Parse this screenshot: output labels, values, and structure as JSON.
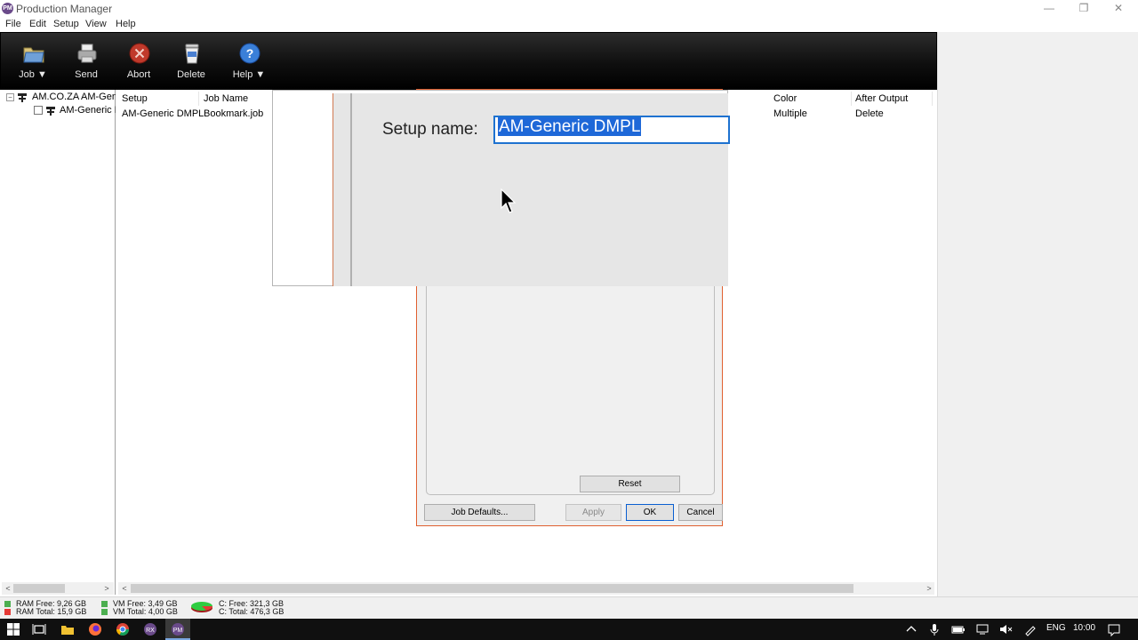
{
  "window": {
    "title": "Production Manager",
    "app_icon_text": "PM",
    "controls": {
      "minimize": "—",
      "restore": "❐",
      "close": "✕"
    }
  },
  "menu": {
    "items": [
      "File",
      "Edit",
      "Setup",
      "View",
      "Help"
    ]
  },
  "toolbar": {
    "job_label": "Job",
    "send_label": "Send",
    "abort_label": "Abort",
    "delete_label": "Delete",
    "help_label": "Help",
    "dropdown_glyph": "▼"
  },
  "tree": {
    "expand_glyph": "−",
    "root_label": "AM.CO.ZA AM-Generic DMPL",
    "child_label": "AM-Generic DMPL"
  },
  "job_list": {
    "columns": [
      "Setup",
      "Job Name",
      "Color",
      "After Output"
    ],
    "rows": [
      {
        "setup": "AM-Generic DMPL",
        "job_name": "Bookmark.job",
        "color": "Multiple",
        "after_output": "Delete"
      }
    ]
  },
  "scroll": {
    "left_arrow": "<",
    "right_arrow": ">"
  },
  "dialog": {
    "reset_label": "Reset",
    "job_defaults_label": "Job Defaults...",
    "apply_label": "Apply",
    "ok_label": "OK",
    "cancel_label": "Cancel"
  },
  "setup_panel": {
    "label": "Setup name:",
    "value": "AM-Generic DMPL"
  },
  "status": {
    "ram_free": "RAM Free: 9,26 GB",
    "ram_total": "RAM Total: 15,9 GB",
    "vm_free": "VM Free: 3,49 GB",
    "vm_total": "VM Total: 4,00 GB",
    "c_free": "C: Free: 321,3 GB",
    "c_total": "C: Total: 476,3 GB",
    "colors": {
      "free": "#4caf50",
      "total": "#e53935"
    }
  },
  "taskbar": {
    "language": "ENG",
    "clock": "10:00"
  },
  "accent": "#1e72d0"
}
